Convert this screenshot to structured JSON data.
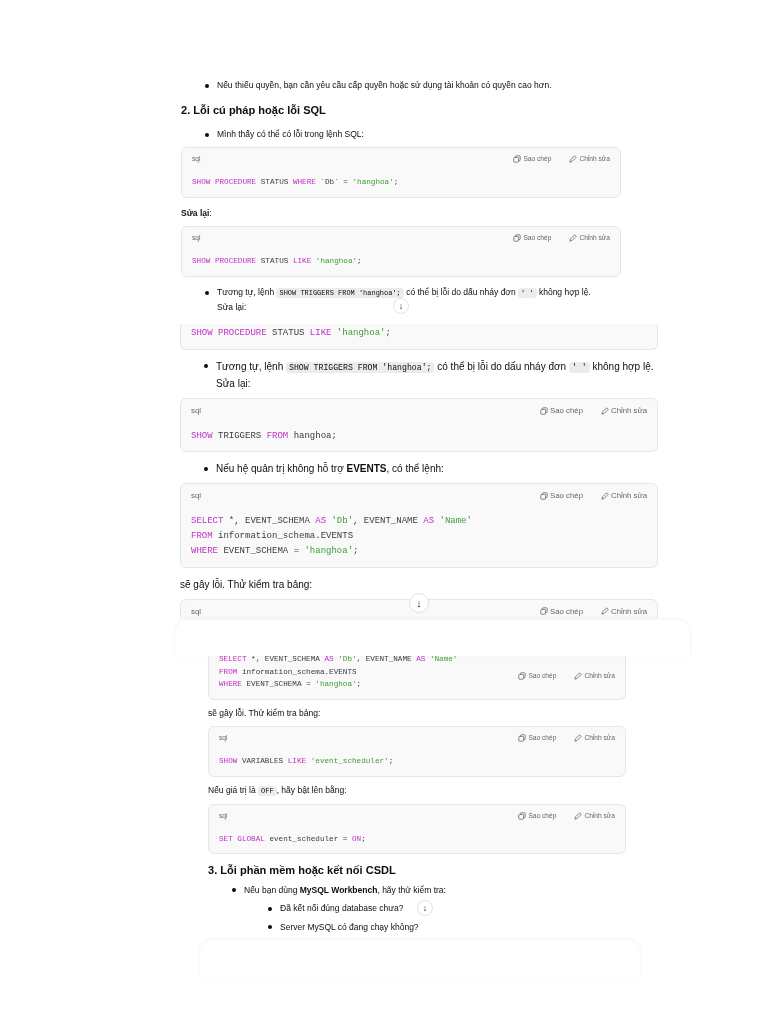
{
  "panels": [
    {
      "scroll_button": "↓",
      "blocks": [
        {
          "kind": "bullet",
          "parts": [
            {
              "kind": "text",
              "text": "Nếu thiếu quyền, bạn cần yêu cầu cấp quyền hoặc sử dụng tài khoản có quyền cao hơn."
            }
          ]
        },
        {
          "kind": "heading",
          "text": "2. Lỗi cú pháp hoặc lỗi SQL"
        },
        {
          "kind": "bullet",
          "parts": [
            {
              "kind": "text",
              "text": "Mình thấy có thể có lỗi trong lệnh SQL:"
            }
          ]
        },
        {
          "kind": "code",
          "language": "sql",
          "copy_label": "Sao chép",
          "edit_label": "Chỉnh sửa",
          "lines": [
            [
              {
                "kind": "keyword",
                "text": "SHOW PROCEDURE"
              },
              {
                "kind": "plain",
                "text": " STATUS "
              },
              {
                "kind": "keyword",
                "text": "WHERE"
              },
              {
                "kind": "plain",
                "text": " `Db` = "
              },
              {
                "kind": "string",
                "text": "'hanghoa'"
              },
              {
                "kind": "plain",
                "text": ";"
              }
            ]
          ]
        },
        {
          "kind": "para",
          "parts": [
            {
              "kind": "text",
              "text": "**Sửa lại**:"
            }
          ]
        },
        {
          "kind": "code",
          "language": "sql",
          "copy_label": "Sao chép",
          "edit_label": "Chỉnh sửa",
          "lines": [
            [
              {
                "kind": "keyword",
                "text": "SHOW PROCEDURE"
              },
              {
                "kind": "plain",
                "text": " STATUS "
              },
              {
                "kind": "keyword",
                "text": "LIKE"
              },
              {
                "kind": "string",
                "text": " 'hanghoa'"
              },
              {
                "kind": "plain",
                "text": ";"
              }
            ]
          ]
        },
        {
          "kind": "bullet",
          "parts": [
            {
              "kind": "text",
              "text": "Tương tự, lệnh "
            },
            {
              "kind": "code",
              "text": "SHOW TRIGGERS FROM 'hanghoa';"
            },
            {
              "kind": "text",
              "text": " có thể bị lỗi do dấu nháy đơn "
            },
            {
              "kind": "code",
              "text": "' '"
            },
            {
              "kind": "text",
              "text": " không hợp lệ."
            }
          ],
          "after": "Sửa lại:"
        }
      ]
    },
    {
      "scroll_button": "↓",
      "blocks": [
        {
          "kind": "code_tail",
          "lines": [
            [
              {
                "kind": "keyword",
                "text": "SHOW PROCEDURE"
              },
              {
                "kind": "plain",
                "text": " STATUS "
              },
              {
                "kind": "keyword",
                "text": "LIKE"
              },
              {
                "kind": "string",
                "text": " 'hanghoa'"
              },
              {
                "kind": "plain",
                "text": ";"
              }
            ]
          ]
        },
        {
          "kind": "bullet",
          "parts": [
            {
              "kind": "text",
              "text": "Tương tự, lệnh "
            },
            {
              "kind": "code",
              "text": "SHOW TRIGGERS FROM 'hanghoa';"
            },
            {
              "kind": "text",
              "text": " có thể bị lỗi do dấu nháy đơn "
            },
            {
              "kind": "code",
              "text": "' '"
            },
            {
              "kind": "text",
              "text": " không hợp lệ."
            }
          ],
          "after": "Sửa lại:"
        },
        {
          "kind": "code",
          "language": "sql",
          "copy_label": "Sao chép",
          "edit_label": "Chỉnh sửa",
          "lines": [
            [
              {
                "kind": "keyword",
                "text": "SHOW"
              },
              {
                "kind": "plain",
                "text": " TRIGGERS "
              },
              {
                "kind": "keyword",
                "text": "FROM"
              },
              {
                "kind": "plain",
                "text": " hanghoa;"
              }
            ]
          ]
        },
        {
          "kind": "bullet",
          "parts": [
            {
              "kind": "text",
              "text": "Nếu hệ quản trị không hỗ trợ **EVENTS**, có thể lệnh:"
            }
          ]
        },
        {
          "kind": "code",
          "language": "sql",
          "copy_label": "Sao chép",
          "edit_label": "Chỉnh sửa",
          "lines": [
            [
              {
                "kind": "keyword",
                "text": "SELECT"
              },
              {
                "kind": "plain",
                "text": " *, EVENT_SCHEMA "
              },
              {
                "kind": "keyword",
                "text": "AS"
              },
              {
                "kind": "string",
                "text": " 'Db'"
              },
              {
                "kind": "plain",
                "text": ", EVENT_NAME "
              },
              {
                "kind": "keyword",
                "text": "AS"
              },
              {
                "kind": "string",
                "text": " 'Name'"
              }
            ],
            [
              {
                "kind": "keyword",
                "text": "FROM"
              },
              {
                "kind": "plain",
                "text": " information_schema.EVENTS"
              }
            ],
            [
              {
                "kind": "keyword",
                "text": "WHERE"
              },
              {
                "kind": "plain",
                "text": " EVENT_SCHEMA = "
              },
              {
                "kind": "string",
                "text": "'hanghoa'"
              },
              {
                "kind": "plain",
                "text": ";"
              }
            ]
          ]
        },
        {
          "kind": "para",
          "parts": [
            {
              "kind": "text",
              "text": "sẽ gây lỗi. Thử kiểm tra bảng:"
            }
          ]
        },
        {
          "kind": "code",
          "language": "sql",
          "copy_label": "Sao chép",
          "edit_label": "Chỉnh sửa"
        }
      ]
    },
    {
      "scroll_button": "↓",
      "blocks": [
        {
          "kind": "code_cut",
          "copy_label": "Sao chép",
          "edit_label": "Chỉnh sửa",
          "lines": [
            [
              {
                "kind": "keyword",
                "text": "SELECT"
              },
              {
                "kind": "plain",
                "text": " *, EVENT_SCHEMA "
              },
              {
                "kind": "keyword",
                "text": "AS"
              },
              {
                "kind": "string",
                "text": " 'Db'"
              },
              {
                "kind": "plain",
                "text": ", EVENT_NAME "
              },
              {
                "kind": "keyword",
                "text": "AS"
              },
              {
                "kind": "string",
                "text": " 'Name'"
              }
            ],
            [
              {
                "kind": "keyword",
                "text": "FROM"
              },
              {
                "kind": "plain",
                "text": " information_schema.EVENTS"
              }
            ],
            [
              {
                "kind": "keyword",
                "text": "WHERE"
              },
              {
                "kind": "plain",
                "text": " EVENT_SCHEMA = "
              },
              {
                "kind": "string",
                "text": "'hanghoa'"
              },
              {
                "kind": "plain",
                "text": ";"
              }
            ]
          ]
        },
        {
          "kind": "para",
          "parts": [
            {
              "kind": "text",
              "text": "sẽ gây lỗi. Thử kiểm tra bảng:"
            }
          ]
        },
        {
          "kind": "code",
          "language": "sql",
          "copy_label": "Sao chép",
          "edit_label": "Chỉnh sửa",
          "lines": [
            [
              {
                "kind": "keyword",
                "text": "SHOW"
              },
              {
                "kind": "plain",
                "text": " VARIABLES "
              },
              {
                "kind": "keyword",
                "text": "LIKE"
              },
              {
                "kind": "string",
                "text": " 'event_scheduler'"
              },
              {
                "kind": "plain",
                "text": ";"
              }
            ]
          ]
        },
        {
          "kind": "para",
          "parts": [
            {
              "kind": "text",
              "text": "Nếu giá trị là "
            },
            {
              "kind": "code",
              "text": "OFF"
            },
            {
              "kind": "text",
              "text": ", hãy bật lên bằng:"
            }
          ]
        },
        {
          "kind": "code",
          "language": "sql",
          "copy_label": "Sao chép",
          "edit_label": "Chỉnh sửa",
          "lines": [
            [
              {
                "kind": "keyword",
                "text": "SET GLOBAL"
              },
              {
                "kind": "plain",
                "text": " event_scheduler = "
              },
              {
                "kind": "keyword",
                "text": "ON"
              },
              {
                "kind": "plain",
                "text": ";"
              }
            ]
          ]
        },
        {
          "kind": "heading",
          "text": "3. Lỗi phần mềm hoặc kết nối CSDL"
        },
        {
          "kind": "bullet",
          "parts": [
            {
              "kind": "text",
              "text": "Nếu bạn dùng **MySQL Workbench**, hãy thử kiểm tra:"
            }
          ],
          "children": [
            {
              "kind": "bullet",
              "parts": [
                {
                  "kind": "text",
                  "text": "Đã kết nối đúng database chưa?"
                }
              ]
            },
            {
              "kind": "bullet",
              "parts": [
                {
                  "kind": "text",
                  "text": "Server MySQL có đang chạy không?"
                }
              ]
            }
          ]
        }
      ]
    }
  ]
}
